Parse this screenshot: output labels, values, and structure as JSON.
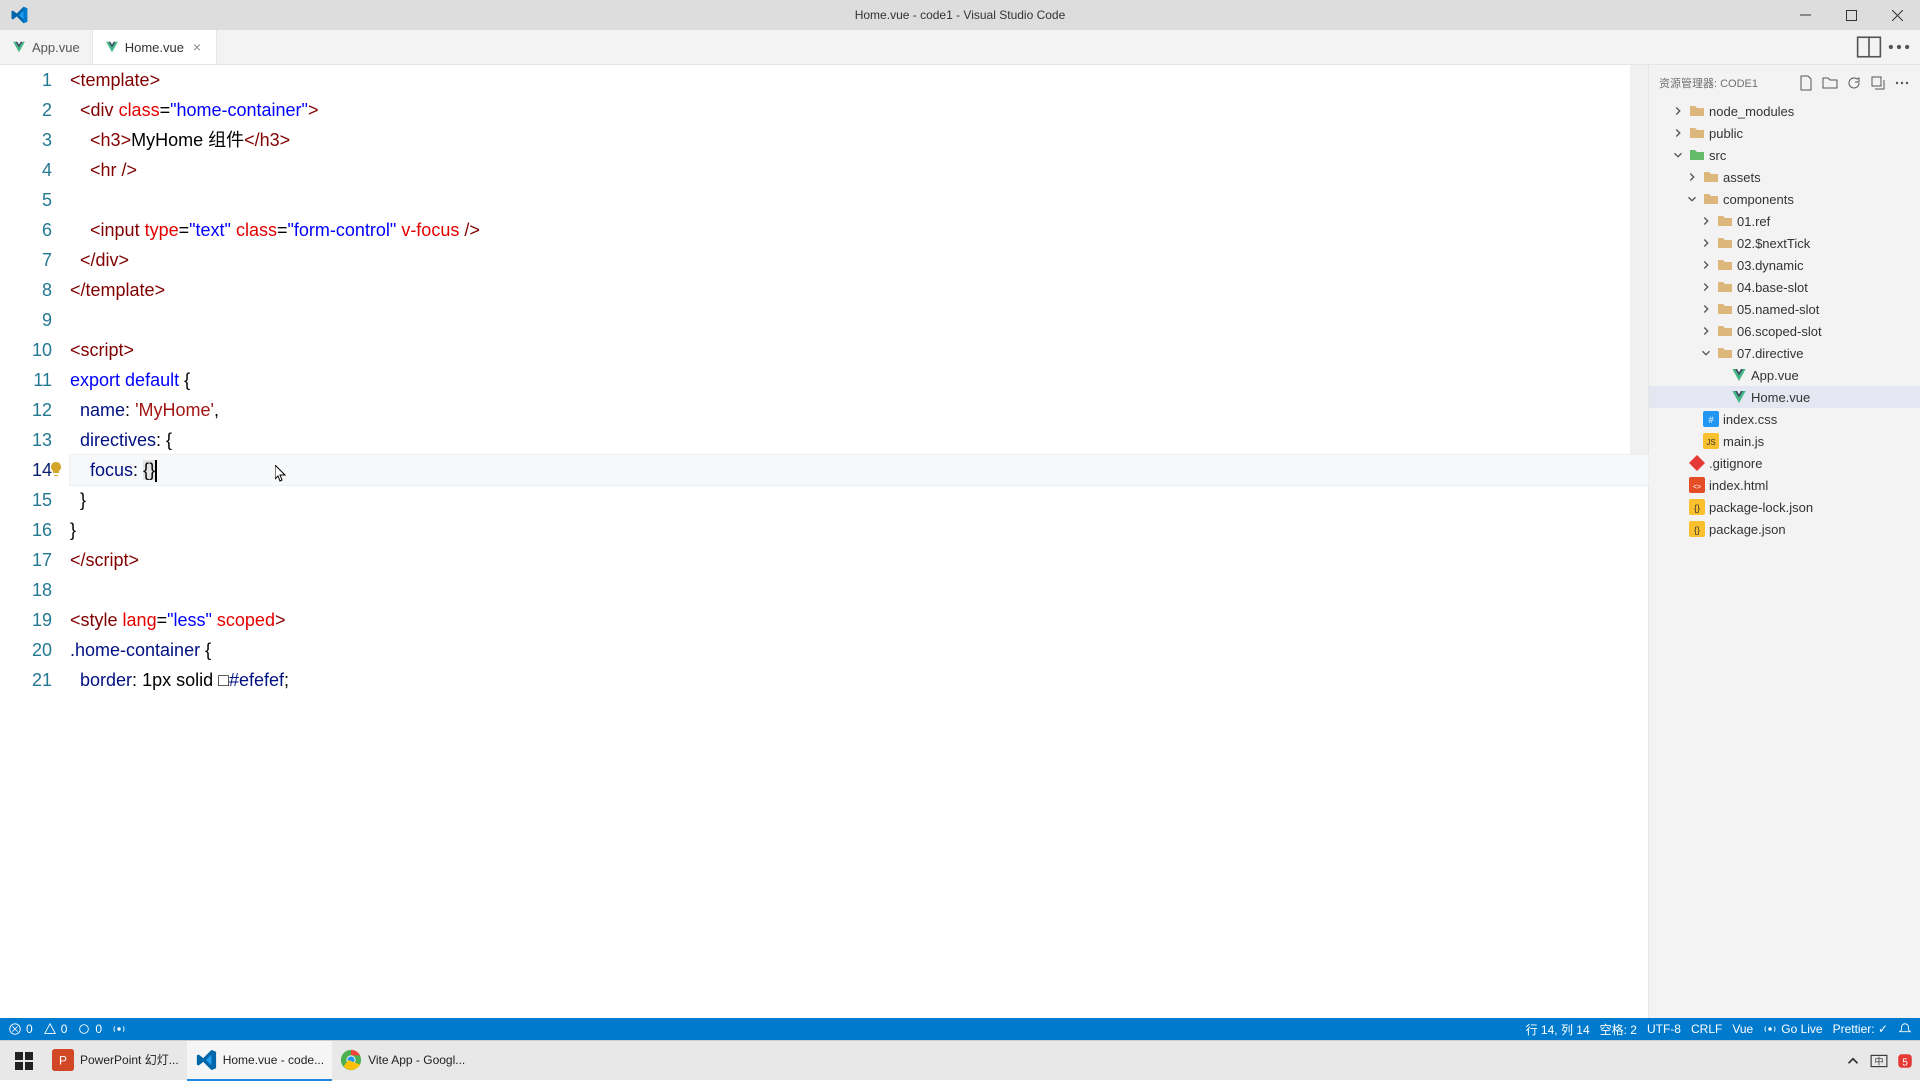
{
  "titlebar": {
    "title": "Home.vue - code1 - Visual Studio Code"
  },
  "tabs": [
    {
      "label": "App.vue",
      "active": false
    },
    {
      "label": "Home.vue",
      "active": true
    }
  ],
  "explorer": {
    "header_label": "资源管理器: CODE1",
    "tree": [
      {
        "name": "node_modules",
        "kind": "folder",
        "indent": 1,
        "open": false
      },
      {
        "name": "public",
        "kind": "folder",
        "indent": 1,
        "open": false
      },
      {
        "name": "src",
        "kind": "folder-src",
        "indent": 1,
        "open": true
      },
      {
        "name": "assets",
        "kind": "folder",
        "indent": 2,
        "open": false
      },
      {
        "name": "components",
        "kind": "folder-comp",
        "indent": 2,
        "open": true
      },
      {
        "name": "01.ref",
        "kind": "folder",
        "indent": 3,
        "open": false
      },
      {
        "name": "02.$nextTick",
        "kind": "folder",
        "indent": 3,
        "open": false
      },
      {
        "name": "03.dynamic",
        "kind": "folder",
        "indent": 3,
        "open": false
      },
      {
        "name": "04.base-slot",
        "kind": "folder",
        "indent": 3,
        "open": false
      },
      {
        "name": "05.named-slot",
        "kind": "folder",
        "indent": 3,
        "open": false
      },
      {
        "name": "06.scoped-slot",
        "kind": "folder",
        "indent": 3,
        "open": false
      },
      {
        "name": "07.directive",
        "kind": "folder",
        "indent": 3,
        "open": true
      },
      {
        "name": "App.vue",
        "kind": "vue",
        "indent": 4
      },
      {
        "name": "Home.vue",
        "kind": "vue",
        "indent": 4,
        "selected": true
      },
      {
        "name": "index.css",
        "kind": "css",
        "indent": 2
      },
      {
        "name": "main.js",
        "kind": "js",
        "indent": 2
      },
      {
        "name": ".gitignore",
        "kind": "git",
        "indent": 1
      },
      {
        "name": "index.html",
        "kind": "html",
        "indent": 1
      },
      {
        "name": "package-lock.json",
        "kind": "json",
        "indent": 1
      },
      {
        "name": "package.json",
        "kind": "json",
        "indent": 1
      }
    ]
  },
  "code": {
    "lines": [
      {
        "n": 1,
        "tokens": [
          [
            "<",
            "tag-brkt"
          ],
          [
            "template",
            "tag-name"
          ],
          [
            ">",
            "tag-brkt"
          ]
        ]
      },
      {
        "n": 2,
        "tokens": [
          [
            "  ",
            ""
          ],
          [
            "<",
            "tag-brkt"
          ],
          [
            "div",
            "tag-name"
          ],
          [
            " ",
            ""
          ],
          [
            "class",
            "attr-name"
          ],
          [
            "=",
            "punct"
          ],
          [
            "\"home-container\"",
            "attr-val"
          ],
          [
            ">",
            "tag-brkt"
          ]
        ]
      },
      {
        "n": 3,
        "tokens": [
          [
            "    ",
            ""
          ],
          [
            "<",
            "tag-brkt"
          ],
          [
            "h3",
            "tag-name"
          ],
          [
            ">",
            "tag-brkt"
          ],
          [
            "MyHome 组件",
            "punct"
          ],
          [
            "</",
            "tag-brkt"
          ],
          [
            "h3",
            "tag-name"
          ],
          [
            ">",
            "tag-brkt"
          ]
        ]
      },
      {
        "n": 4,
        "tokens": [
          [
            "    ",
            ""
          ],
          [
            "<",
            "tag-brkt"
          ],
          [
            "hr",
            "tag-name"
          ],
          [
            " />",
            "tag-brkt"
          ]
        ]
      },
      {
        "n": 5,
        "tokens": []
      },
      {
        "n": 6,
        "tokens": [
          [
            "    ",
            ""
          ],
          [
            "<",
            "tag-brkt"
          ],
          [
            "input",
            "tag-name"
          ],
          [
            " ",
            ""
          ],
          [
            "type",
            "attr-name"
          ],
          [
            "=",
            "punct"
          ],
          [
            "\"text\"",
            "attr-val"
          ],
          [
            " ",
            ""
          ],
          [
            "class",
            "attr-name"
          ],
          [
            "=",
            "punct"
          ],
          [
            "\"form-control\"",
            "attr-val"
          ],
          [
            " ",
            ""
          ],
          [
            "v-focus",
            "attr-name"
          ],
          [
            " />",
            "tag-brkt"
          ]
        ]
      },
      {
        "n": 7,
        "tokens": [
          [
            "  ",
            ""
          ],
          [
            "</",
            "tag-brkt"
          ],
          [
            "div",
            "tag-name"
          ],
          [
            ">",
            "tag-brkt"
          ]
        ]
      },
      {
        "n": 8,
        "tokens": [
          [
            "</",
            "tag-brkt"
          ],
          [
            "template",
            "tag-name"
          ],
          [
            ">",
            "tag-brkt"
          ]
        ]
      },
      {
        "n": 9,
        "tokens": []
      },
      {
        "n": 10,
        "tokens": [
          [
            "<",
            "tag-brkt"
          ],
          [
            "script",
            "tag-name"
          ],
          [
            ">",
            "tag-brkt"
          ]
        ]
      },
      {
        "n": 11,
        "tokens": [
          [
            "export",
            "kw"
          ],
          [
            " ",
            ""
          ],
          [
            "default",
            "kw"
          ],
          [
            " {",
            "punct"
          ]
        ]
      },
      {
        "n": 12,
        "tokens": [
          [
            "  ",
            ""
          ],
          [
            "name",
            "prop"
          ],
          [
            ": ",
            "punct"
          ],
          [
            "'MyHome'",
            "str"
          ],
          [
            ",",
            "punct"
          ]
        ]
      },
      {
        "n": 13,
        "tokens": [
          [
            "  ",
            ""
          ],
          [
            "directives",
            "prop"
          ],
          [
            ": {",
            "punct"
          ]
        ]
      },
      {
        "n": 14,
        "tokens": [
          [
            "    ",
            ""
          ],
          [
            "focus",
            "prop"
          ],
          [
            ": ",
            "punct"
          ],
          [
            "{",
            "punct bracket-hl"
          ],
          [
            "}",
            "punct bracket-hl"
          ]
        ],
        "current": true,
        "bulb": true,
        "cursor": true
      },
      {
        "n": 15,
        "tokens": [
          [
            "  }",
            "punct"
          ]
        ]
      },
      {
        "n": 16,
        "tokens": [
          [
            "}",
            "punct"
          ]
        ]
      },
      {
        "n": 17,
        "tokens": [
          [
            "</",
            "tag-brkt"
          ],
          [
            "script",
            "tag-name"
          ],
          [
            ">",
            "tag-brkt"
          ]
        ]
      },
      {
        "n": 18,
        "tokens": []
      },
      {
        "n": 19,
        "tokens": [
          [
            "<",
            "tag-brkt"
          ],
          [
            "style",
            "tag-name"
          ],
          [
            " ",
            ""
          ],
          [
            "lang",
            "attr-name"
          ],
          [
            "=",
            "punct"
          ],
          [
            "\"less\"",
            "attr-val"
          ],
          [
            " ",
            ""
          ],
          [
            "scoped",
            "attr-name"
          ],
          [
            ">",
            "tag-brkt"
          ]
        ]
      },
      {
        "n": 20,
        "tokens": [
          [
            ".home-container",
            "prop"
          ],
          [
            " {",
            "punct"
          ]
        ]
      },
      {
        "n": 21,
        "tokens": [
          [
            "  ",
            ""
          ],
          [
            "border",
            "prop"
          ],
          [
            ": ",
            "punct"
          ],
          [
            "1px solid ",
            "punct"
          ],
          [
            "□",
            "punct"
          ],
          [
            "#efefef",
            "prop"
          ],
          [
            ";",
            "punct"
          ]
        ],
        "truncated": true
      }
    ]
  },
  "statusbar": {
    "errors": "0",
    "warnings": "0",
    "port": "0",
    "position": "行 14, 列 14",
    "spaces": "空格: 2",
    "encoding": "UTF-8",
    "eol": "CRLF",
    "lang": "Vue",
    "golive": "Go Live",
    "prettier": "Prettier: ✓"
  },
  "taskbar": {
    "items": [
      {
        "label": "PowerPoint 幻灯...",
        "app": "powerpoint"
      },
      {
        "label": "Home.vue - code...",
        "app": "vscode",
        "active": true
      },
      {
        "label": "Vite App - Googl...",
        "app": "chrome"
      }
    ]
  }
}
